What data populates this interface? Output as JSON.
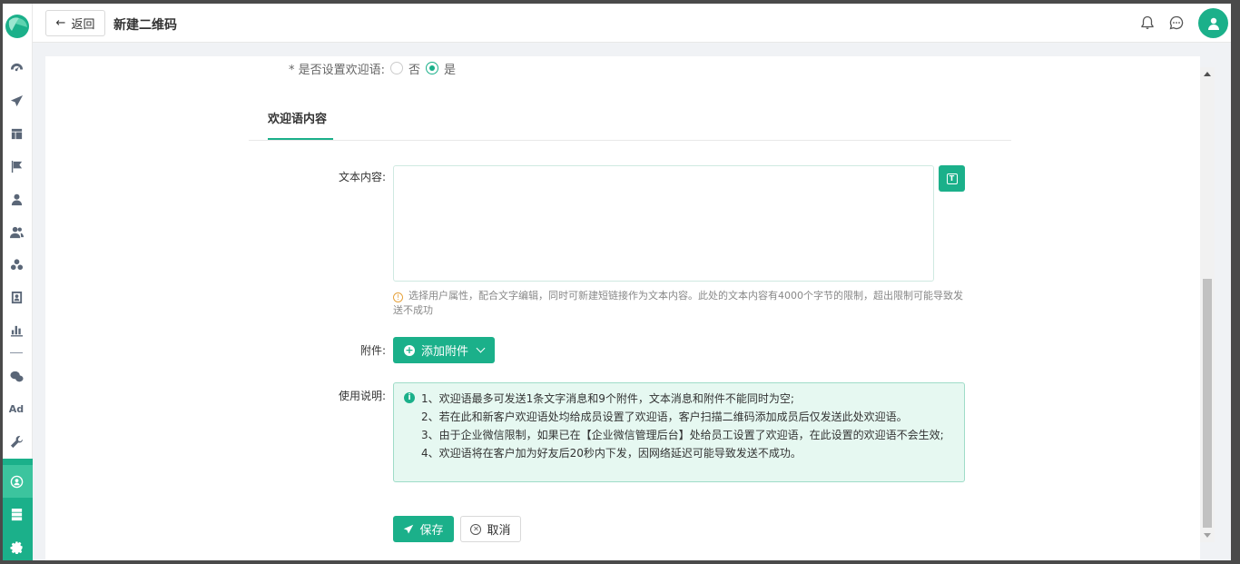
{
  "topbar": {
    "back_label": "返回",
    "page_title": "新建二维码"
  },
  "form": {
    "welcome_question_label": "* 是否设置欢迎语:",
    "welcome_option_no": "否",
    "welcome_option_yes": "是",
    "welcome_selected": "是",
    "section_title": "欢迎语内容",
    "text_content_label": "文本内容:",
    "text_content_value": "",
    "hint": "选择用户属性，配合文字编辑，同时可新建短链接作为文本内容。此处的文本内容有4000个字节的限制，超出限制可能导致发送不成功",
    "attachment_label": "附件:",
    "add_attachment_label": "添加附件",
    "usage_label": "使用说明:",
    "usage_lines": [
      "1、欢迎语最多可发送1条文字消息和9个附件，文本消息和附件不能同时为空;",
      "2、若在此和新客户欢迎语处均给成员设置了欢迎语，客户扫描二维码添加成员后仅发送此处欢迎语。",
      "3、由于企业微信限制，如果已在【企业微信管理后台】处给员工设置了欢迎语，在此设置的欢迎语不会生效;",
      "4、欢迎语将在客户加为好友后20秒内下发，因网络延迟可能导致发送不成功。"
    ],
    "save_label": "保存",
    "cancel_label": "取消"
  },
  "sidebar": {
    "items": [
      "dashboard-icon",
      "send-icon",
      "layout-icon",
      "flag-icon",
      "user-icon",
      "users-icon",
      "group-icon",
      "contact-card-icon",
      "bar-chart-icon",
      "wechat-icon",
      "ad-icon",
      "wrench-icon",
      "customer-ops-icon",
      "server-icon",
      "settings-icon"
    ],
    "ad_text": "Ad"
  },
  "colors": {
    "accent": "#1bb08a",
    "notice_bg": "#e6f8f1",
    "notice_border": "#9fdcc8"
  }
}
